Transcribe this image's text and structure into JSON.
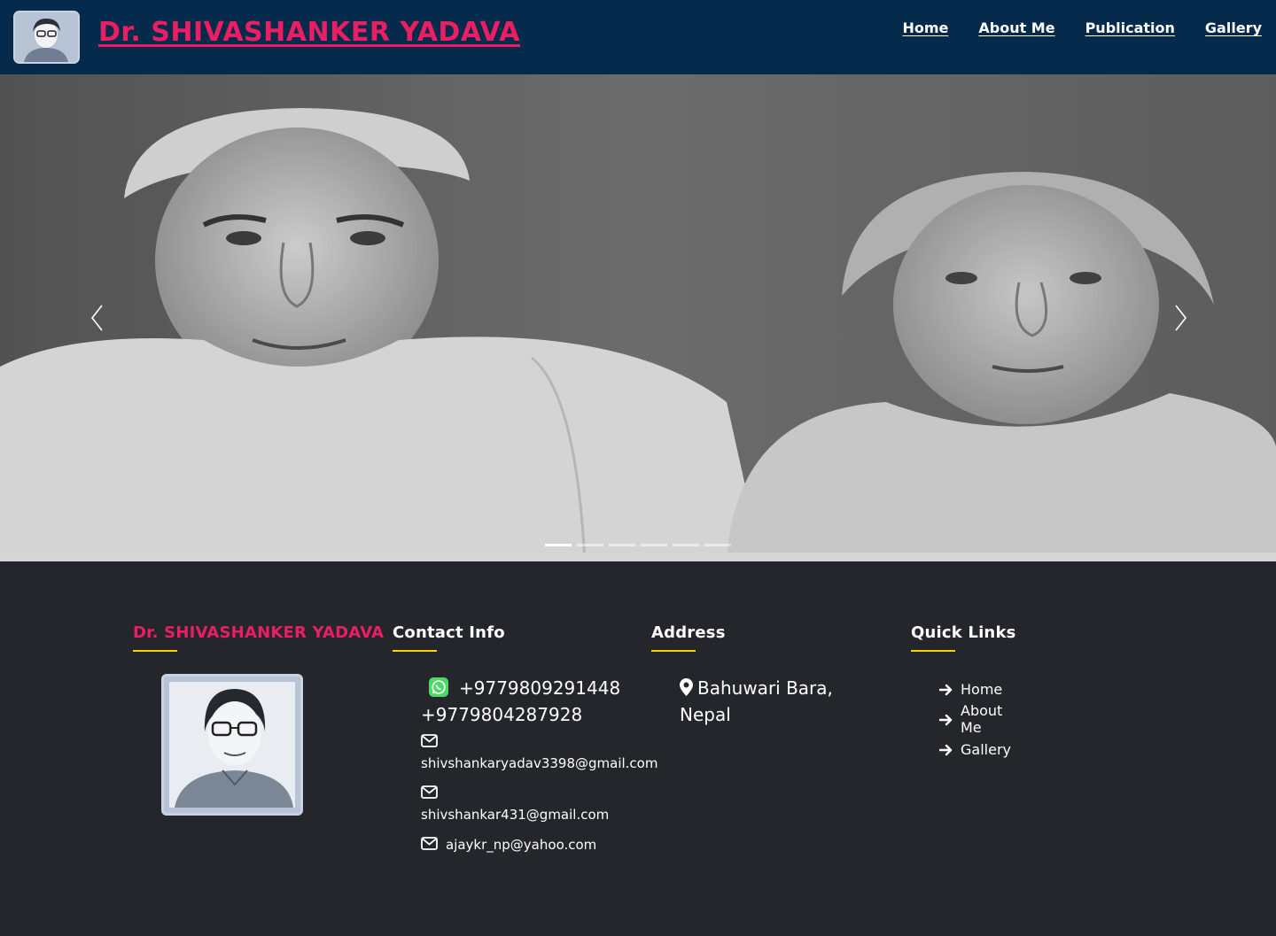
{
  "header": {
    "site_title": "Dr. SHIVASHANKER YADAVA",
    "nav": [
      "Home",
      "About Me",
      "Publication",
      "Gallery"
    ]
  },
  "hero": {
    "slide_count": 6,
    "active_slide": 1,
    "prev_icon": "chevron-left-icon",
    "next_icon": "chevron-right-icon"
  },
  "footer": {
    "about": {
      "title": "Dr. SHIVASHANKER YADAVA"
    },
    "contact": {
      "title": "Contact Info",
      "phone_1": "+9779809291448",
      "phone_2": "+9779804287928",
      "email_1": "shivshankaryadav3398@gmail.com",
      "email_2": "shivshankar431@gmail.com",
      "email_3": "ajaykr_np@yahoo.com"
    },
    "address": {
      "title": "Address",
      "text": "Bahuwari Bara, Nepal"
    },
    "quick_links": {
      "title": "Quick Links",
      "items": [
        "Home",
        "About Me",
        "Gallery"
      ]
    }
  },
  "colors": {
    "header_bg": "#062a4b",
    "brand_pink": "#e91e63",
    "accent_yellow": "#ffd400",
    "footer_bg": "#25252c"
  }
}
